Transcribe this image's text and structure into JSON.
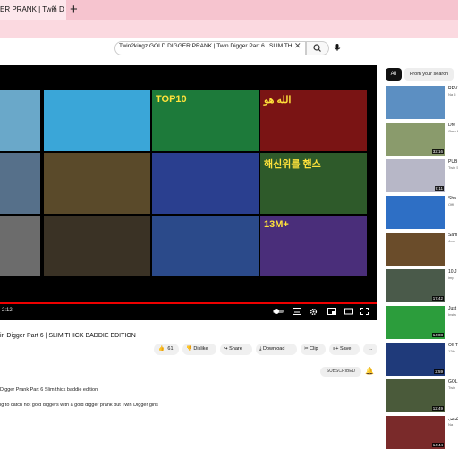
{
  "browser": {
    "tab_title": "ER PRANK | Twin D",
    "tab_close": "×",
    "new_tab": "+"
  },
  "header": {
    "search_value": "Twin2kingz GOLD DIGGER PRANK | Twin Digger Part 6 | SLIM THICK BA"
  },
  "player": {
    "thumbnails": [
      {
        "label": "",
        "bg": "#6aa8c9"
      },
      {
        "label": "",
        "bg": "#3aa6d8"
      },
      {
        "label": "TOP10",
        "bg": "#1d7a3a"
      },
      {
        "label": "الله هو",
        "bg": "#7a1414"
      },
      {
        "label": "",
        "bg": "#56708a"
      },
      {
        "label": "",
        "bg": "#5a4a2a"
      },
      {
        "label": "",
        "bg": "#2a3f8f"
      },
      {
        "label": "해신위를 핸스",
        "bg": "#2e5a2a"
      },
      {
        "label": "",
        "bg": "#6c6c6c"
      },
      {
        "label": "",
        "bg": "#3a3225"
      },
      {
        "label": "",
        "bg": "#2b4a8a"
      },
      {
        "label": "13M+",
        "bg": "#4a2e7a"
      }
    ],
    "time": "2:12"
  },
  "video": {
    "title": "in Digger Part 6 | SLIM THICK BADDIE EDITION",
    "actions": {
      "likes": "61",
      "dislike": "Dislike",
      "share": "Share",
      "download": "Download",
      "clip": "Clip",
      "save": "Save",
      "more": "..."
    },
    "subscribed": "SUBSCRIBED",
    "description_line1": "Digger Prank Part 6 Slim thick baddie edition",
    "description_line2": "ig to catch not gold diggers with a gold digger prank but Twin Digger girls"
  },
  "sidebar": {
    "chip_all": "All",
    "chip_from": "From your search",
    "items": [
      {
        "title": "REV",
        "sub": "Na 5",
        "duration": "",
        "bg": "#5c8fc2"
      },
      {
        "title": "Dre",
        "sub": "Gam 60K",
        "duration": "32:16",
        "bg": "#8a9b6c"
      },
      {
        "title": "PUB",
        "sub": "Twin 5.3",
        "duration": "9:11",
        "bg": "#b7b7c7"
      },
      {
        "title": "Sha",
        "sub": "Offi",
        "duration": "",
        "bg": "#2e6fc5"
      },
      {
        "title": "Sam",
        "sub": "Awa",
        "duration": "",
        "bg": "#6a4c2a"
      },
      {
        "title": "10 J",
        "sub": "imp",
        "duration": "17:42",
        "bg": "#4a5a4a"
      },
      {
        "title": "Just",
        "sub": "Insta",
        "duration": "14:08",
        "bg": "#2c9d3c"
      },
      {
        "title": "Off T",
        "sub": "12th",
        "duration": "2:59",
        "bg": "#1f3a7a"
      },
      {
        "title": "GOL",
        "sub": "Twin",
        "duration": "12:49",
        "bg": "#4a5a3a"
      },
      {
        "title": "عرس",
        "sub": "Na",
        "duration": "14:44",
        "bg": "#7a2a2a"
      }
    ]
  },
  "colors": {
    "tabbar": "#f6c4cf",
    "progress": "#e00000"
  }
}
